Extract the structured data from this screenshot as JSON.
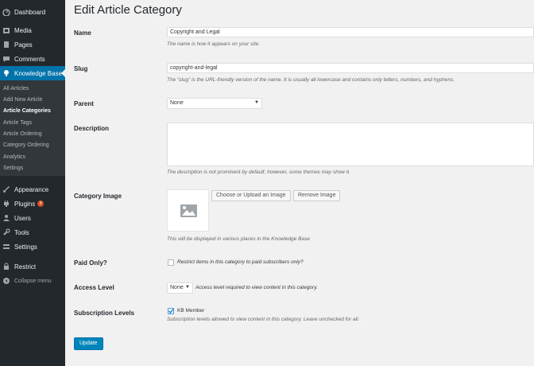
{
  "sidebar": {
    "items": [
      {
        "label": "Dashboard"
      },
      {
        "label": "Media"
      },
      {
        "label": "Pages"
      },
      {
        "label": "Comments"
      },
      {
        "label": "Knowledge Base"
      },
      {
        "label": "Appearance"
      },
      {
        "label": "Plugins",
        "badge": "8"
      },
      {
        "label": "Users"
      },
      {
        "label": "Tools"
      },
      {
        "label": "Settings"
      },
      {
        "label": "Restrict"
      },
      {
        "label": "Collapse menu"
      }
    ],
    "submenu": [
      {
        "label": "All Articles"
      },
      {
        "label": "Add New Article"
      },
      {
        "label": "Article Categories"
      },
      {
        "label": "Article Tags"
      },
      {
        "label": "Article Ordering"
      },
      {
        "label": "Category Ordering"
      },
      {
        "label": "Analytics"
      },
      {
        "label": "Settings"
      }
    ]
  },
  "page": {
    "title": "Edit Article Category"
  },
  "form": {
    "name": {
      "label": "Name",
      "value": "Copyright and Legal",
      "description": "The name is how it appears on your site."
    },
    "slug": {
      "label": "Slug",
      "value": "copyright-and-legal",
      "description": "The “slug” is the URL-friendly version of the name. It is usually all lowercase and contains only letters, numbers, and hyphens."
    },
    "parent": {
      "label": "Parent",
      "value": "None"
    },
    "description": {
      "label": "Description",
      "value": "",
      "note": "The description is not prominent by default; however, some themes may show it."
    },
    "category_image": {
      "label": "Category Image",
      "upload_label": "Choose or Upload an Image",
      "remove_label": "Remove Image",
      "note": "This will be displayed in various places in the Knowledge Base"
    },
    "paid_only": {
      "label": "Paid Only?",
      "checkbox_label": "Restrict items in this category to paid subscribers only?",
      "checked": false
    },
    "access_level": {
      "label": "Access Level",
      "value": "None",
      "note": "Access level required to view content in this category."
    },
    "subscription_levels": {
      "label": "Subscription Levels",
      "option": "KB Member",
      "checked": true,
      "note": "Subscription levels allowed to view content in this category. Leave unchecked for all."
    },
    "update_label": "Update"
  },
  "colors": {
    "sidebar_bg": "#23282d",
    "active": "#0073aa",
    "button_primary": "#0085ba",
    "badge": "#d54e21"
  }
}
